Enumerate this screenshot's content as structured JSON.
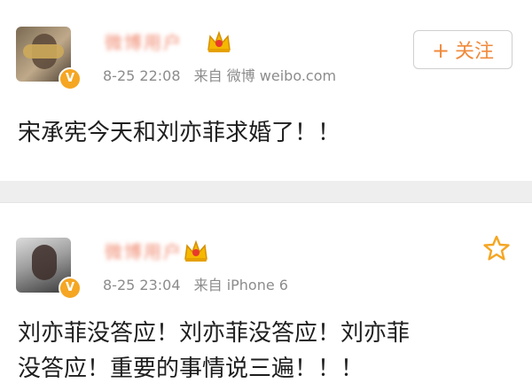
{
  "posts": [
    {
      "username": "微博用户",
      "timestamp": "8-25 22:08",
      "source": "来自 微博 weibo.com",
      "follow_label": "关注",
      "text": "宋承宪今天和刘亦菲求婚了！！"
    },
    {
      "username": "微博用户",
      "timestamp": "8-25 23:04",
      "source": "来自 iPhone 6",
      "text_line1": "刘亦菲没答应！刘亦菲没答应！刘亦菲",
      "text_line2": "没答应！重要的事情说三遍！！！"
    }
  ],
  "icons": {
    "verified": "verified-badge-icon",
    "crown": "crown-icon",
    "star": "star-icon",
    "plus": "plus-icon"
  },
  "colors": {
    "accent": "#f08a3c",
    "verified": "#f5a623",
    "meta_text": "#8c8c8c"
  }
}
